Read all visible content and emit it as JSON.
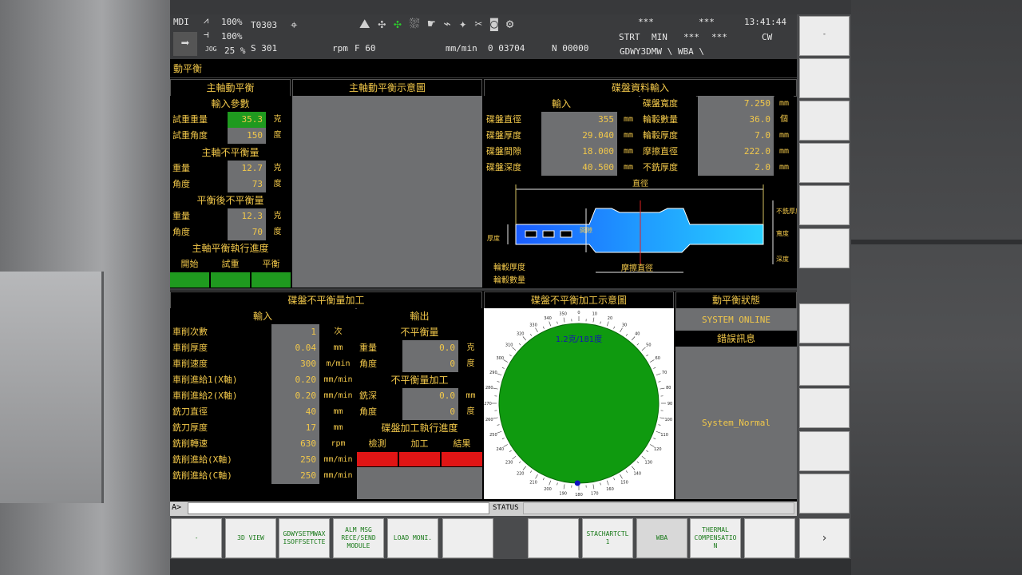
{
  "header": {
    "mode": "MDI",
    "feed_ovr_label": "100%",
    "spindle_ovr_label": "100%",
    "jog_label": "JOG",
    "jog_ovr": "25 %",
    "tool": "T0303",
    "spindle_cmd": "S 301",
    "rpm_unit": "rpm",
    "feed_cmd": "F 60",
    "feed_unit": "mm/min",
    "feed_val": "0 03704",
    "n_val": "N 00000",
    "stars1": "***",
    "stars2": "***",
    "time": "13:41:44",
    "strt": "STRT",
    "min": "MIN",
    "stars3": "***",
    "stars4": "***",
    "cw": "CW",
    "path": "GDWY3DMW \\ WBA \\"
  },
  "page_title": "動平衡",
  "left": {
    "title": "主軸動平衡",
    "input_title": "輸入參數",
    "rows_in": [
      {
        "label": "試重重量",
        "value": "35.3",
        "unit": "克"
      },
      {
        "label": "試重角度",
        "value": "150",
        "unit": "度"
      }
    ],
    "imbalance_title": "主軸不平衡量",
    "rows_imb": [
      {
        "label": "重量",
        "value": "12.7",
        "unit": "克"
      },
      {
        "label": "角度",
        "value": "73",
        "unit": "度"
      }
    ],
    "after_title": "平衡後不平衡量",
    "rows_after": [
      {
        "label": "重量",
        "value": "12.3",
        "unit": "克"
      },
      {
        "label": "角度",
        "value": "70",
        "unit": "度"
      }
    ],
    "progress_title": "主軸平衡執行進度",
    "progress_cols": [
      "開始",
      "試重",
      "平衡"
    ]
  },
  "diagram_title": "主軸動平衡示意圖",
  "disc": {
    "title": "碟盤資料輸入",
    "input_label": "輸入",
    "rows": [
      {
        "l1": "碟盤直徑",
        "v1": "355",
        "u1": "mm",
        "l2": "輪轂數量",
        "v2": "36.0",
        "u2": "個"
      },
      {
        "l1": "碟盤厚度",
        "v1": "29.040",
        "u1": "mm",
        "l2": "輪轂厚度",
        "v2": "7.0",
        "u2": "mm"
      },
      {
        "l1": "碟盤間隙",
        "v1": "18.000",
        "u1": "mm",
        "l2": "摩擦直徑",
        "v2": "222.0",
        "u2": "mm"
      },
      {
        "l1": "碟盤深度",
        "v1": "40.500",
        "u1": "mm",
        "l2": "不銑厚度",
        "v2": "2.0",
        "u2": "mm"
      }
    ],
    "width_label": "碟盤寬度",
    "width_value": "7.250",
    "width_unit": "mm",
    "drawing": {
      "diameter": "直徑",
      "hub_count": "輪轂數量",
      "hub_thick": "輪轂厚度",
      "friction_dia": "摩擦直徑",
      "gap": "間隙",
      "depth": "深度",
      "no_mill": "不銑厚度",
      "width": "寬度",
      "thick": "厚度"
    }
  },
  "machining": {
    "title": "碟盤不平衡量加工",
    "input_title": "輸入",
    "rows": [
      {
        "label": "車削次數",
        "value": "1",
        "unit": "次"
      },
      {
        "label": "車削厚度",
        "value": "0.04",
        "unit": "mm"
      },
      {
        "label": "車削速度",
        "value": "300",
        "unit": "m/min"
      },
      {
        "label": "車削進給1(X軸)",
        "value": "0.20",
        "unit": "mm/min"
      },
      {
        "label": "車削進給2(X軸)",
        "value": "0.20",
        "unit": "mm/min"
      },
      {
        "label": "銑刀直徑",
        "value": "40",
        "unit": "mm"
      },
      {
        "label": "銑刀厚度",
        "value": "17",
        "unit": "mm"
      },
      {
        "label": "銑削轉速",
        "value": "630",
        "unit": "rpm"
      },
      {
        "label": "銑削進給(X軸)",
        "value": "250",
        "unit": "mm/min"
      },
      {
        "label": "銑削進給(C軸)",
        "value": "250",
        "unit": "mm/min"
      }
    ],
    "output_title": "輸出",
    "unbal_title": "不平衡量",
    "out_rows": [
      {
        "label": "重量",
        "value": "0.0",
        "unit": "克"
      },
      {
        "label": "角度",
        "value": "0",
        "unit": "度"
      }
    ],
    "machining_title": "不平衡量加工",
    "mach_rows": [
      {
        "label": "銑深",
        "value": "0.0",
        "unit": "mm"
      },
      {
        "label": "角度",
        "value": "0",
        "unit": "度"
      }
    ],
    "progress_title": "碟盤加工執行進度",
    "progress_cols": [
      "檢測",
      "加工",
      "結果"
    ]
  },
  "dial": {
    "title": "碟盤不平衡加工示意圖",
    "readout": "1.2克/181度",
    "ticks": [
      "0",
      "10",
      "20",
      "30",
      "40",
      "50",
      "60",
      "70",
      "80",
      "90",
      "100",
      "110",
      "120",
      "130",
      "140",
      "150",
      "160",
      "170",
      "180",
      "190",
      "200",
      "210",
      "220",
      "230",
      "240",
      "250",
      "260",
      "270",
      "280",
      "290",
      "300",
      "310",
      "320",
      "330",
      "340",
      "350"
    ],
    "marker_angle_deg": 181,
    "color": "#0f9a0f"
  },
  "status_panel": {
    "title": "動平衡狀態",
    "system": "SYSTEM ONLINE",
    "err_title": "錯誤訊息",
    "message": "System_Normal"
  },
  "cmd": {
    "prompt": "A>",
    "status": "STATUS"
  },
  "softkeys": [
    {
      "label": "-"
    },
    {
      "label": "3D VIEW"
    },
    {
      "label": "GDWYSETMWAX ISOFFSETCTE"
    },
    {
      "label": "ALM MSG RECE/SEND MODULE"
    },
    {
      "label": "LOAD MONI."
    },
    {
      "label": ""
    },
    {
      "label": ""
    },
    {
      "label": "STACHARTCTL 1"
    },
    {
      "label": "WBA"
    },
    {
      "label": "THERMAL COMPENSATIO N"
    },
    {
      "label": ""
    },
    {
      "label": "›"
    }
  ],
  "vkeys": [
    {
      "label": "-"
    },
    {
      "label": ""
    },
    {
      "label": ""
    },
    {
      "label": ""
    },
    {
      "label": ""
    },
    {
      "label": ""
    },
    {
      "label": ""
    },
    {
      "label": ""
    },
    {
      "label": ""
    },
    {
      "label": ""
    },
    {
      "label": ""
    }
  ]
}
